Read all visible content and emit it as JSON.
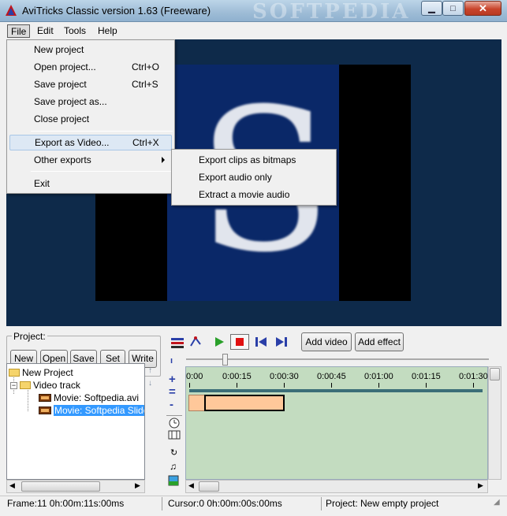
{
  "window": {
    "title": "AviTricks Classic version 1.63 (Freeware)",
    "watermark": "SOFTPEDIA",
    "minimize": "▁",
    "maximize": "□",
    "close": "✕"
  },
  "menubar": {
    "items": [
      "File",
      "Edit",
      "Tools",
      "Help"
    ]
  },
  "file_menu": {
    "items": [
      {
        "label": "New project",
        "shortcut": ""
      },
      {
        "label": "Open project...",
        "shortcut": "Ctrl+O"
      },
      {
        "label": "Save project",
        "shortcut": "Ctrl+S"
      },
      {
        "label": "Save project as...",
        "shortcut": ""
      },
      {
        "label": "Close project",
        "shortcut": ""
      },
      {
        "label": "Export as Video...",
        "shortcut": "Ctrl+X"
      },
      {
        "label": "Other exports",
        "shortcut": ""
      },
      {
        "label": "Exit",
        "shortcut": ""
      }
    ]
  },
  "submenu": {
    "items": [
      "Export clips as bitmaps",
      "Export audio only",
      "Extract a movie audio"
    ]
  },
  "project": {
    "group_label": "Project:",
    "buttons": [
      "New",
      "Open",
      "Save",
      "Set",
      "Write"
    ],
    "tree": {
      "root": "New Project",
      "track": "Video track",
      "items": [
        "Movie: Softpedia.avi",
        "Movie: Softpedia Slides"
      ]
    }
  },
  "timeline": {
    "buttons": {
      "add_video": "Add video",
      "add_effect": "Add effect"
    },
    "ticks": [
      "0:00",
      "0:00:15",
      "0:00:30",
      "0:00:45",
      "0:01:00",
      "0:01:15",
      "0:01:30"
    ],
    "side_tools": [
      "+",
      "=",
      "-"
    ]
  },
  "statusbar": {
    "frame": "Frame:11   0h:00m:11s:00ms",
    "cursor": "Cursor:0   0h:00m:00s:00ms",
    "project": "Project: New empty project"
  },
  "colors": {
    "timeline_bg": "#c3dcc0",
    "clip": "#ffc89a",
    "track_line": "#3b6e78",
    "video_bg": "#0e2a4a",
    "selection": "#3399ff"
  }
}
